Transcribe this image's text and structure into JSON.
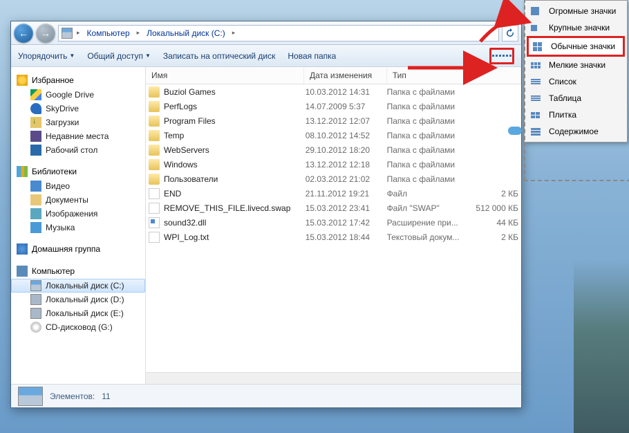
{
  "breadcrumb": {
    "seg1": "Компьютер",
    "seg2": "Локальный диск (C:)"
  },
  "toolbar": {
    "organize": "Упорядочить",
    "share": "Общий доступ",
    "burn": "Записать на оптический диск",
    "newfolder": "Новая папка"
  },
  "nav": {
    "fav": "Избранное",
    "fav_items": [
      "Google Drive",
      "SkyDrive",
      "Загрузки",
      "Недавние места",
      "Рабочий стол"
    ],
    "lib": "Библиотеки",
    "lib_items": [
      "Видео",
      "Документы",
      "Изображения",
      "Музыка"
    ],
    "home": "Домашняя группа",
    "comp": "Компьютер",
    "comp_items": [
      "Локальный диск (C:)",
      "Локальный диск (D:)",
      "Локальный диск (E:)",
      "CD-дисковод (G:)"
    ]
  },
  "cols": {
    "name": "Имя",
    "date": "Дата изменения",
    "type": "Тип",
    "size": ""
  },
  "rows": [
    {
      "ico": "folder",
      "name": "Buziol Games",
      "date": "10.03.2012 14:31",
      "type": "Папка с файлами",
      "size": ""
    },
    {
      "ico": "folder",
      "name": "PerfLogs",
      "date": "14.07.2009 5:37",
      "type": "Папка с файлами",
      "size": ""
    },
    {
      "ico": "folder",
      "name": "Program Files",
      "date": "13.12.2012 12:07",
      "type": "Папка с файлами",
      "size": ""
    },
    {
      "ico": "folder",
      "name": "Temp",
      "date": "08.10.2012 14:52",
      "type": "Папка с файлами",
      "size": ""
    },
    {
      "ico": "folder",
      "name": "WebServers",
      "date": "29.10.2012 18:20",
      "type": "Папка с файлами",
      "size": ""
    },
    {
      "ico": "folder",
      "name": "Windows",
      "date": "13.12.2012 12:18",
      "type": "Папка с файлами",
      "size": ""
    },
    {
      "ico": "folder",
      "name": "Пользователи",
      "date": "02.03.2012 21:02",
      "type": "Папка с файлами",
      "size": ""
    },
    {
      "ico": "file",
      "name": "END",
      "date": "21.11.2012 19:21",
      "type": "Файл",
      "size": "2 КБ"
    },
    {
      "ico": "swap",
      "name": "REMOVE_THIS_FILE.livecd.swap",
      "date": "15.03.2012 23:41",
      "type": "Файл \"SWAP\"",
      "size": "512 000 КБ"
    },
    {
      "ico": "dll",
      "name": "sound32.dll",
      "date": "15.03.2012 17:42",
      "type": "Расширение при...",
      "size": "44 КБ"
    },
    {
      "ico": "txt",
      "name": "WPI_Log.txt",
      "date": "15.03.2012 18:44",
      "type": "Текстовый докум...",
      "size": "2 КБ"
    }
  ],
  "status": {
    "label": "Элементов:",
    "count": "11"
  },
  "viewmenu": [
    {
      "k": "huge",
      "label": "Огромные значки"
    },
    {
      "k": "large",
      "label": "Крупные значки"
    },
    {
      "k": "med",
      "label": "Обычные значки",
      "hl": true
    },
    {
      "k": "small",
      "label": "Мелкие значки"
    },
    {
      "k": "list",
      "label": "Список"
    },
    {
      "k": "table",
      "label": "Таблица"
    },
    {
      "k": "tile",
      "label": "Плитка"
    },
    {
      "k": "content",
      "label": "Содержимое"
    }
  ]
}
